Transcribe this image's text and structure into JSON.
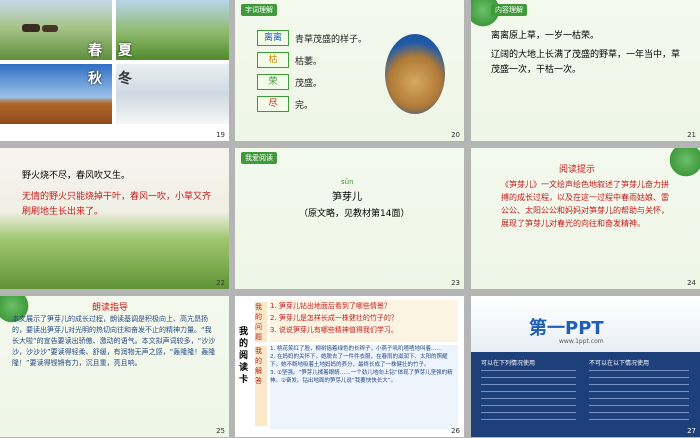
{
  "slides": [
    {
      "num": "19",
      "seasons": {
        "spring": "春",
        "summer": "夏",
        "autumn": "秋",
        "winter": "冬"
      }
    },
    {
      "num": "20",
      "tag": "字词理解",
      "words": [
        {
          "w": "离离",
          "d": "青草茂盛的样子。",
          "color": "#1d5fb5"
        },
        {
          "w": "枯",
          "d": "枯萎。",
          "color": "#c98a00"
        },
        {
          "w": "荣",
          "d": "茂盛。",
          "color": "#3e9a3a"
        },
        {
          "w": "尽",
          "d": "完。",
          "color": "#c21d1d"
        }
      ]
    },
    {
      "num": "21",
      "tag": "内容理解",
      "line1": "离离原上草，一岁一枯荣。",
      "line2": "辽阔的大地上长满了茂盛的野草，一年当中，草茂盛一次，干枯一次。"
    },
    {
      "num": "22",
      "poem": "野火烧不尽，春风吹又生。",
      "trans": "无情的野火只能烧掉干叶，春风一吹，小草又齐刷刷地生长出来了。"
    },
    {
      "num": "23",
      "tag": "我爱阅读",
      "pinyin": "sǔn",
      "title": "笋芽儿",
      "subtitle": "（原文略，见教材第14面）"
    },
    {
      "num": "24",
      "heading": "阅读提示",
      "body": "《笋芽儿》一文绘声绘色地叙述了笋芽儿奋力拼搏的成长过程，以及在这一过程中春雨姑娘、雷公公、太阳公公和妈妈对笋芽儿的帮助与关怀，展现了笋芽儿对春光的向往和奋发精神。"
    },
    {
      "num": "25",
      "heading": "朗读指导",
      "body": "本文展示了笋芽儿的成长过程，朗读基调是积极向上、高亢昂扬的，要读出笋芽儿对光明的热切向往和奋发不止的精神力量。“我长大啦”的宣告要读出骄傲、激动的语气。本文拟声词较多，“沙沙沙，沙沙沙”要读得轻柔、舒缓，有润物无声之感，“轰隆隆！轰隆隆！”要读得铿锵有力，沉且重，亮且响。"
    },
    {
      "num": "26",
      "side": "我的阅读卡",
      "q_label": "我的问题",
      "a_label": "我的解答",
      "questions": [
        "1. 笋芽儿钻出地面后看到了哪些情景？",
        "2. 笋芽儿是怎样长成一株健壮的竹子的？",
        "3. 说说笋芽儿有哪些精神值得我们学习。"
      ],
      "answers": [
        "1. 桃花笑红了脸，柳树摇着绿色的长辫子，小燕子叽叽喳喳地叫着……",
        "2. 在妈妈的关怀下，她脱去了一件件衣服，在春雨的滋润下、太阳的照耀下，她不断地吸着土地妈妈的养分，最终长成了一株健壮的竹子。",
        "3. ①坚强。“笋芽儿揉着眼睛……一个劲儿地向上钻”体现了笋芽儿坚强的精神。②奋发。钻出地面的笋芽儿说“我要快快长大”。"
      ]
    },
    {
      "num": "27",
      "logo": "第一PPT",
      "url": "www.1ppt.com",
      "left_title": "可以在下列情况使用",
      "right_title": "不可以在以下情况使用"
    }
  ],
  "colors": {
    "green": "#3e9a3a",
    "red": "#c21d1d",
    "blue": "#1d5fb5"
  }
}
